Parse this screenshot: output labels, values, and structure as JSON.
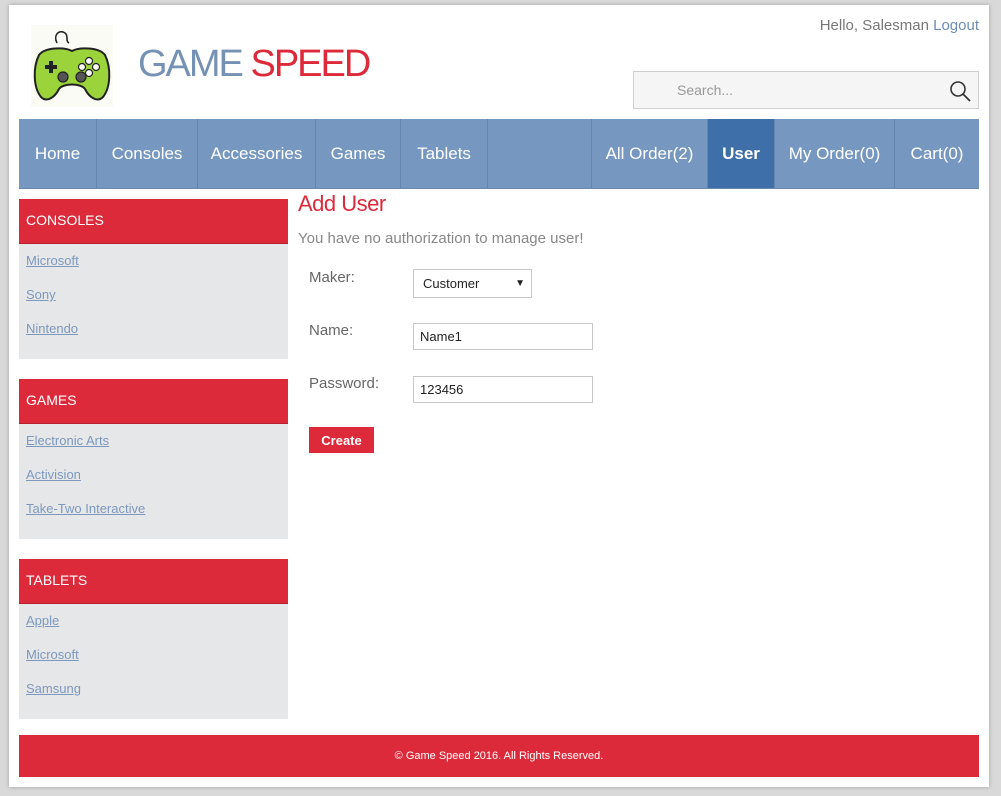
{
  "header": {
    "brand_word1": "GAME",
    "brand_word2": "SPEED",
    "greeting": "Hello, Salesman",
    "logout_label": "Logout",
    "search_placeholder": "Search..."
  },
  "nav": {
    "left": [
      "Home",
      "Consoles",
      "Accessories",
      "Games",
      "Tablets"
    ],
    "right": [
      "All Order(2)",
      "User",
      "My Order(0)",
      "Cart(0)"
    ],
    "active": "User"
  },
  "sidebar": {
    "sections": [
      {
        "title": "CONSOLES",
        "links": [
          "Microsoft",
          "Sony",
          "Nintendo"
        ]
      },
      {
        "title": "GAMES",
        "links": [
          "Electronic Arts",
          "Activision",
          "Take-Two Interactive"
        ]
      },
      {
        "title": "TABLETS",
        "links": [
          "Apple",
          "Microsoft",
          "Samsung"
        ]
      }
    ]
  },
  "main": {
    "title": "Add User",
    "message": "You have no authorization to manage user!",
    "form": {
      "maker_label": "Maker:",
      "maker_value": "Customer",
      "name_label": "Name:",
      "name_value": "Name1",
      "password_label": "Password:",
      "password_value": "123456",
      "create_label": "Create"
    }
  },
  "footer": {
    "text": "© Game Speed 2016. All Rights Reserved."
  },
  "colors": {
    "brand_red": "#dd2a3a",
    "nav_blue": "#7697bf",
    "nav_active": "#3f6fa8",
    "brand_blue": "#7592b4"
  }
}
